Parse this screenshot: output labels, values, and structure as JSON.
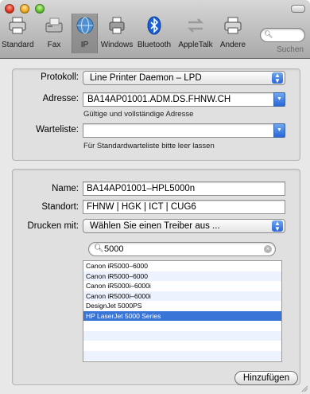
{
  "toolbar": {
    "items": [
      {
        "label": "Standard",
        "icon": "printer-icon"
      },
      {
        "label": "Fax",
        "icon": "fax-icon"
      },
      {
        "label": "IP",
        "icon": "globe-icon"
      },
      {
        "label": "Windows",
        "icon": "windows-printer-icon"
      },
      {
        "label": "Bluetooth",
        "icon": "bluetooth-icon"
      },
      {
        "label": "AppleTalk",
        "icon": "appletalk-icon"
      },
      {
        "label": "Andere",
        "icon": "printer-icon"
      }
    ],
    "search_label": "Suchen"
  },
  "connection": {
    "protocol_label": "Protokoll:",
    "protocol_value": "Line Printer Daemon – LPD",
    "address_label": "Adresse:",
    "address_value": "BA14AP01001.ADM.DS.FHNW.CH",
    "address_hint": "Gültige und vollständige Adresse",
    "queue_label": "Warteliste:",
    "queue_value": "",
    "queue_hint": "Für Standardwarteliste bitte leer lassen"
  },
  "printer": {
    "name_label": "Name:",
    "name_value": "BA14AP01001–HPL5000n",
    "location_label": "Standort:",
    "location_value": "FHNW | HGK | ICT | CUG6",
    "driver_label": "Drucken mit:",
    "driver_value": "Wählen Sie einen Treiber aus ...",
    "driver_search_value": "5000",
    "drivers": [
      "Canon iR5000–6000",
      "Canon iR5000–6000",
      "Canon iR5000i–6000i",
      "Canon iR5000i–6000i",
      "DesignJet 5000PS",
      "HP LaserJet 5000 Series"
    ],
    "selected_driver_index": 5
  },
  "actions": {
    "add_label": "Hinzufügen"
  },
  "colors": {
    "selection": "#3875d7",
    "accent": "#2a66d9"
  }
}
